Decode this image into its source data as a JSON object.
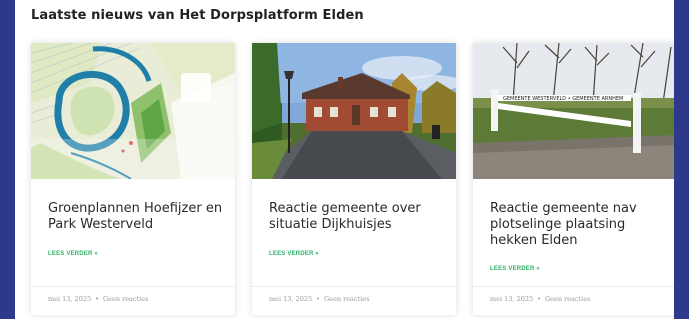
{
  "section_title": "Laatste nieuws van Het Dorpsplatform Elden",
  "cards": [
    {
      "title": "Groenplannen Hoefijzer en Park Westerveld",
      "read_more": "LEES VERDER »",
      "date": "mei 13, 2025",
      "separator": "•",
      "comments": "Geen reacties",
      "image_icon": "map-image"
    },
    {
      "title": "Reactie gemeente over situatie Dijkhuisjes",
      "read_more": "LEES VERDER »",
      "date": "mei 13, 2025",
      "separator": "•",
      "comments": "Geen reacties",
      "image_icon": "houses-photo"
    },
    {
      "title": "Reactie gemeente nav plotselinge plaatsing hekken Elden",
      "read_more": "LEES VERDER »",
      "date": "mei 13, 2025",
      "separator": "•",
      "comments": "Geen reacties",
      "image_icon": "gate-photo",
      "sign_text": "GEMEENTE WESTERVELD • GEMEENTE ARNHEM"
    }
  ],
  "colors": {
    "background": "#2d3a8c",
    "accent": "#2eb26a"
  }
}
